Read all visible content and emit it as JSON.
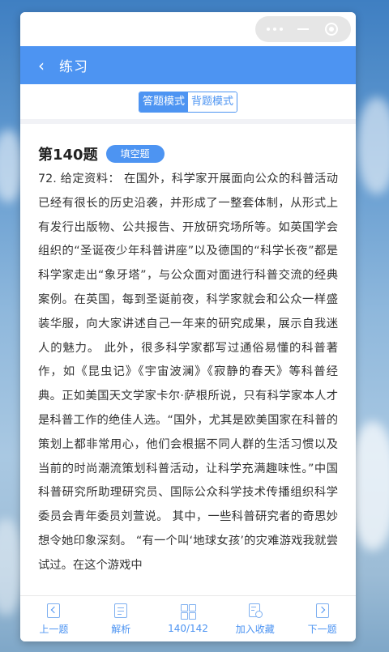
{
  "nav": {
    "back_symbol": "‹",
    "title": "练习"
  },
  "modes": {
    "answer": "答题模式",
    "memorize": "背题模式",
    "active": "answer"
  },
  "question": {
    "number_label": "第140题",
    "type_badge": "填空题",
    "text": "72. 给定资料： 在国外，科学家开展面向公众的科普活动已经有很长的历史沿袭，并形成了一整套体制，从形式上有发行出版物、公共报告、开放研究场所等。如英国学会组织的“圣诞夜少年科普讲座”以及德国的“科学长夜”都是科学家走出“象牙塔”，与公众面对面进行科普交流的经典案例。在英国，每到圣诞前夜，科学家就会和公众一样盛装华服，向大家讲述自己一年来的研究成果，展示自我迷人的魅力。 此外，很多科学家都写过通俗易懂的科普著作，如《昆虫记》《宇宙波澜》《寂静的春天》等科普经典。正如美国天文学家卡尔·萨根所说，只有科学家本人才是科普工作的绝佳人选。“国外，尤其是欧美国家在科普的策划上都非常用心，他们会根据不同人群的生活习惯以及当前的时尚潮流策划科普活动，让科学充满趣味性。”中国科普研究所助理研究员、国际公众科学技术传播组织科学委员会青年委员刘萱说。 其中，一些科普研究者的奇思妙想令她印象深刻。 “有一个叫‘地球女孩’的灾难游戏我就尝试过。在这个游戏中"
  },
  "bottom_bar": {
    "prev": "上一题",
    "analysis": "解析",
    "progress": "140/142",
    "favorite": "加入收藏",
    "next": "下一题"
  },
  "icons": {
    "capsule": [
      "more-dots-icon",
      "minimize-icon",
      "close-circle-icon"
    ],
    "tabs": [
      "prev-icon",
      "analysis-icon",
      "grid-icon",
      "favorite-icon",
      "next-icon"
    ]
  },
  "colors": {
    "primary": "#4d94f2",
    "page_bg": "#f1f2f6"
  }
}
